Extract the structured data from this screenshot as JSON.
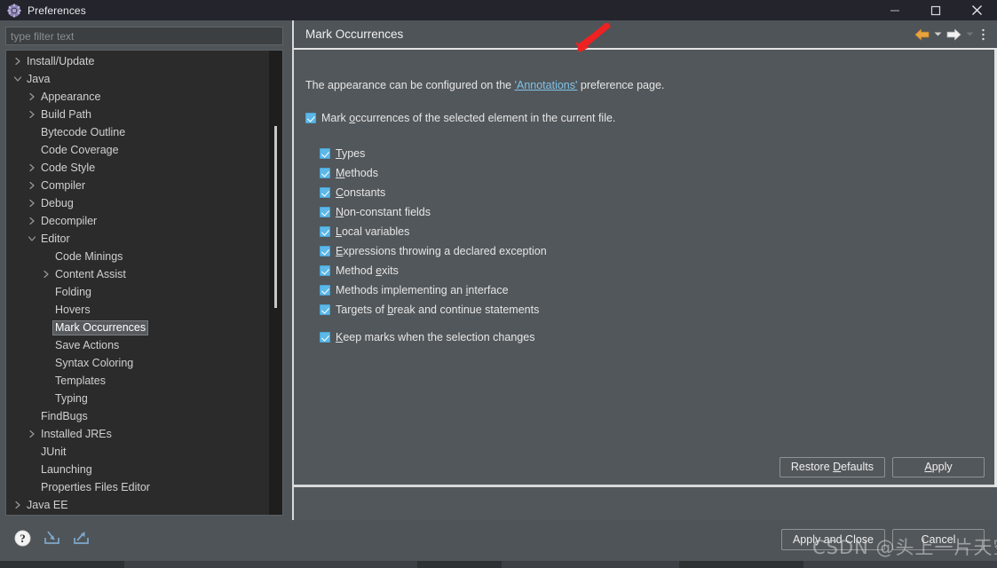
{
  "window": {
    "title": "Preferences",
    "icon": "gear-icon",
    "controls": {
      "minimize": "minimize-icon",
      "maximize": "maximize-icon",
      "close": "close-icon"
    }
  },
  "sidebar": {
    "filter": {
      "value": "",
      "placeholder": "type filter text"
    },
    "items": [
      {
        "label": "Install/Update",
        "indent": 0,
        "twisty": "collapsed",
        "selected": false
      },
      {
        "label": "Java",
        "indent": 0,
        "twisty": "expanded",
        "selected": false
      },
      {
        "label": "Appearance",
        "indent": 1,
        "twisty": "collapsed",
        "selected": false
      },
      {
        "label": "Build Path",
        "indent": 1,
        "twisty": "collapsed",
        "selected": false
      },
      {
        "label": "Bytecode Outline",
        "indent": 1,
        "twisty": "none",
        "selected": false
      },
      {
        "label": "Code Coverage",
        "indent": 1,
        "twisty": "none",
        "selected": false
      },
      {
        "label": "Code Style",
        "indent": 1,
        "twisty": "collapsed",
        "selected": false
      },
      {
        "label": "Compiler",
        "indent": 1,
        "twisty": "collapsed",
        "selected": false
      },
      {
        "label": "Debug",
        "indent": 1,
        "twisty": "collapsed",
        "selected": false
      },
      {
        "label": "Decompiler",
        "indent": 1,
        "twisty": "collapsed",
        "selected": false
      },
      {
        "label": "Editor",
        "indent": 1,
        "twisty": "expanded",
        "selected": false
      },
      {
        "label": "Code Minings",
        "indent": 2,
        "twisty": "none",
        "selected": false
      },
      {
        "label": "Content Assist",
        "indent": 2,
        "twisty": "collapsed",
        "selected": false
      },
      {
        "label": "Folding",
        "indent": 2,
        "twisty": "none",
        "selected": false
      },
      {
        "label": "Hovers",
        "indent": 2,
        "twisty": "none",
        "selected": false
      },
      {
        "label": "Mark Occurrences",
        "indent": 2,
        "twisty": "none",
        "selected": true
      },
      {
        "label": "Save Actions",
        "indent": 2,
        "twisty": "none",
        "selected": false
      },
      {
        "label": "Syntax Coloring",
        "indent": 2,
        "twisty": "none",
        "selected": false
      },
      {
        "label": "Templates",
        "indent": 2,
        "twisty": "none",
        "selected": false
      },
      {
        "label": "Typing",
        "indent": 2,
        "twisty": "none",
        "selected": false
      },
      {
        "label": "FindBugs",
        "indent": 1,
        "twisty": "none",
        "selected": false
      },
      {
        "label": "Installed JREs",
        "indent": 1,
        "twisty": "collapsed",
        "selected": false
      },
      {
        "label": "JUnit",
        "indent": 1,
        "twisty": "none",
        "selected": false
      },
      {
        "label": "Launching",
        "indent": 1,
        "twisty": "none",
        "selected": false
      },
      {
        "label": "Properties Files Editor",
        "indent": 1,
        "twisty": "none",
        "selected": false
      },
      {
        "label": "Java EE",
        "indent": 0,
        "twisty": "collapsed",
        "selected": false
      }
    ]
  },
  "pane": {
    "title": "Mark Occurrences",
    "tools": {
      "back": "back-arrow-icon",
      "back_menu": "chevron-down-icon",
      "forward": "forward-arrow-icon",
      "forward_menu": "chevron-down-icon",
      "overflow": "vertical-dots-icon"
    },
    "intro": {
      "before": "The appearance can be configured on the ",
      "link": "'Annotations'",
      "after": " preference page."
    },
    "master_checkbox": {
      "checked": true,
      "pre": "Mark ",
      "mnemonic": "o",
      "post": "ccurrences of the selected element in the current file."
    },
    "options": [
      {
        "checked": true,
        "pre": "",
        "mnemonic": "T",
        "post": "ypes"
      },
      {
        "checked": true,
        "pre": "",
        "mnemonic": "M",
        "post": "ethods"
      },
      {
        "checked": true,
        "pre": "",
        "mnemonic": "C",
        "post": "onstants"
      },
      {
        "checked": true,
        "pre": "",
        "mnemonic": "N",
        "post": "on-constant fields"
      },
      {
        "checked": true,
        "pre": "",
        "mnemonic": "L",
        "post": "ocal variables"
      },
      {
        "checked": true,
        "pre": "",
        "mnemonic": "E",
        "post": "xpressions throwing a declared exception"
      },
      {
        "checked": true,
        "pre": "Method ",
        "mnemonic": "e",
        "post": "xits"
      },
      {
        "checked": true,
        "pre": "Methods implementing an ",
        "mnemonic": "i",
        "post": "nterface"
      },
      {
        "checked": true,
        "pre": "Targets of ",
        "mnemonic": "b",
        "post": "reak and continue statements"
      }
    ],
    "keep_marks": {
      "checked": true,
      "pre": "",
      "mnemonic": "K",
      "post": "eep marks when the selection changes"
    },
    "buttons": {
      "restore_defaults": {
        "pre": "Restore ",
        "mnemonic": "D",
        "post": "efaults"
      },
      "apply": {
        "pre": "",
        "mnemonic": "A",
        "post": "pply"
      }
    }
  },
  "footer": {
    "icons": [
      {
        "name": "help-icon"
      },
      {
        "name": "import-icon"
      },
      {
        "name": "export-icon"
      }
    ],
    "buttons": {
      "apply_and_close": "Apply and Close",
      "cancel": "Cancel"
    }
  },
  "overlays": {
    "arrow": {
      "name": "red-annotation-arrow",
      "color": "#ee2222"
    },
    "watermark": "CSDN @头上一片天空"
  },
  "colors": {
    "titlebar": "#23242c",
    "pane_bg": "#52575b",
    "sidebar_bg": "#2b2b2b",
    "checkbox": "#5cb8e8",
    "link": "#7fc3e8",
    "back_arrow": "#e8a33d"
  }
}
